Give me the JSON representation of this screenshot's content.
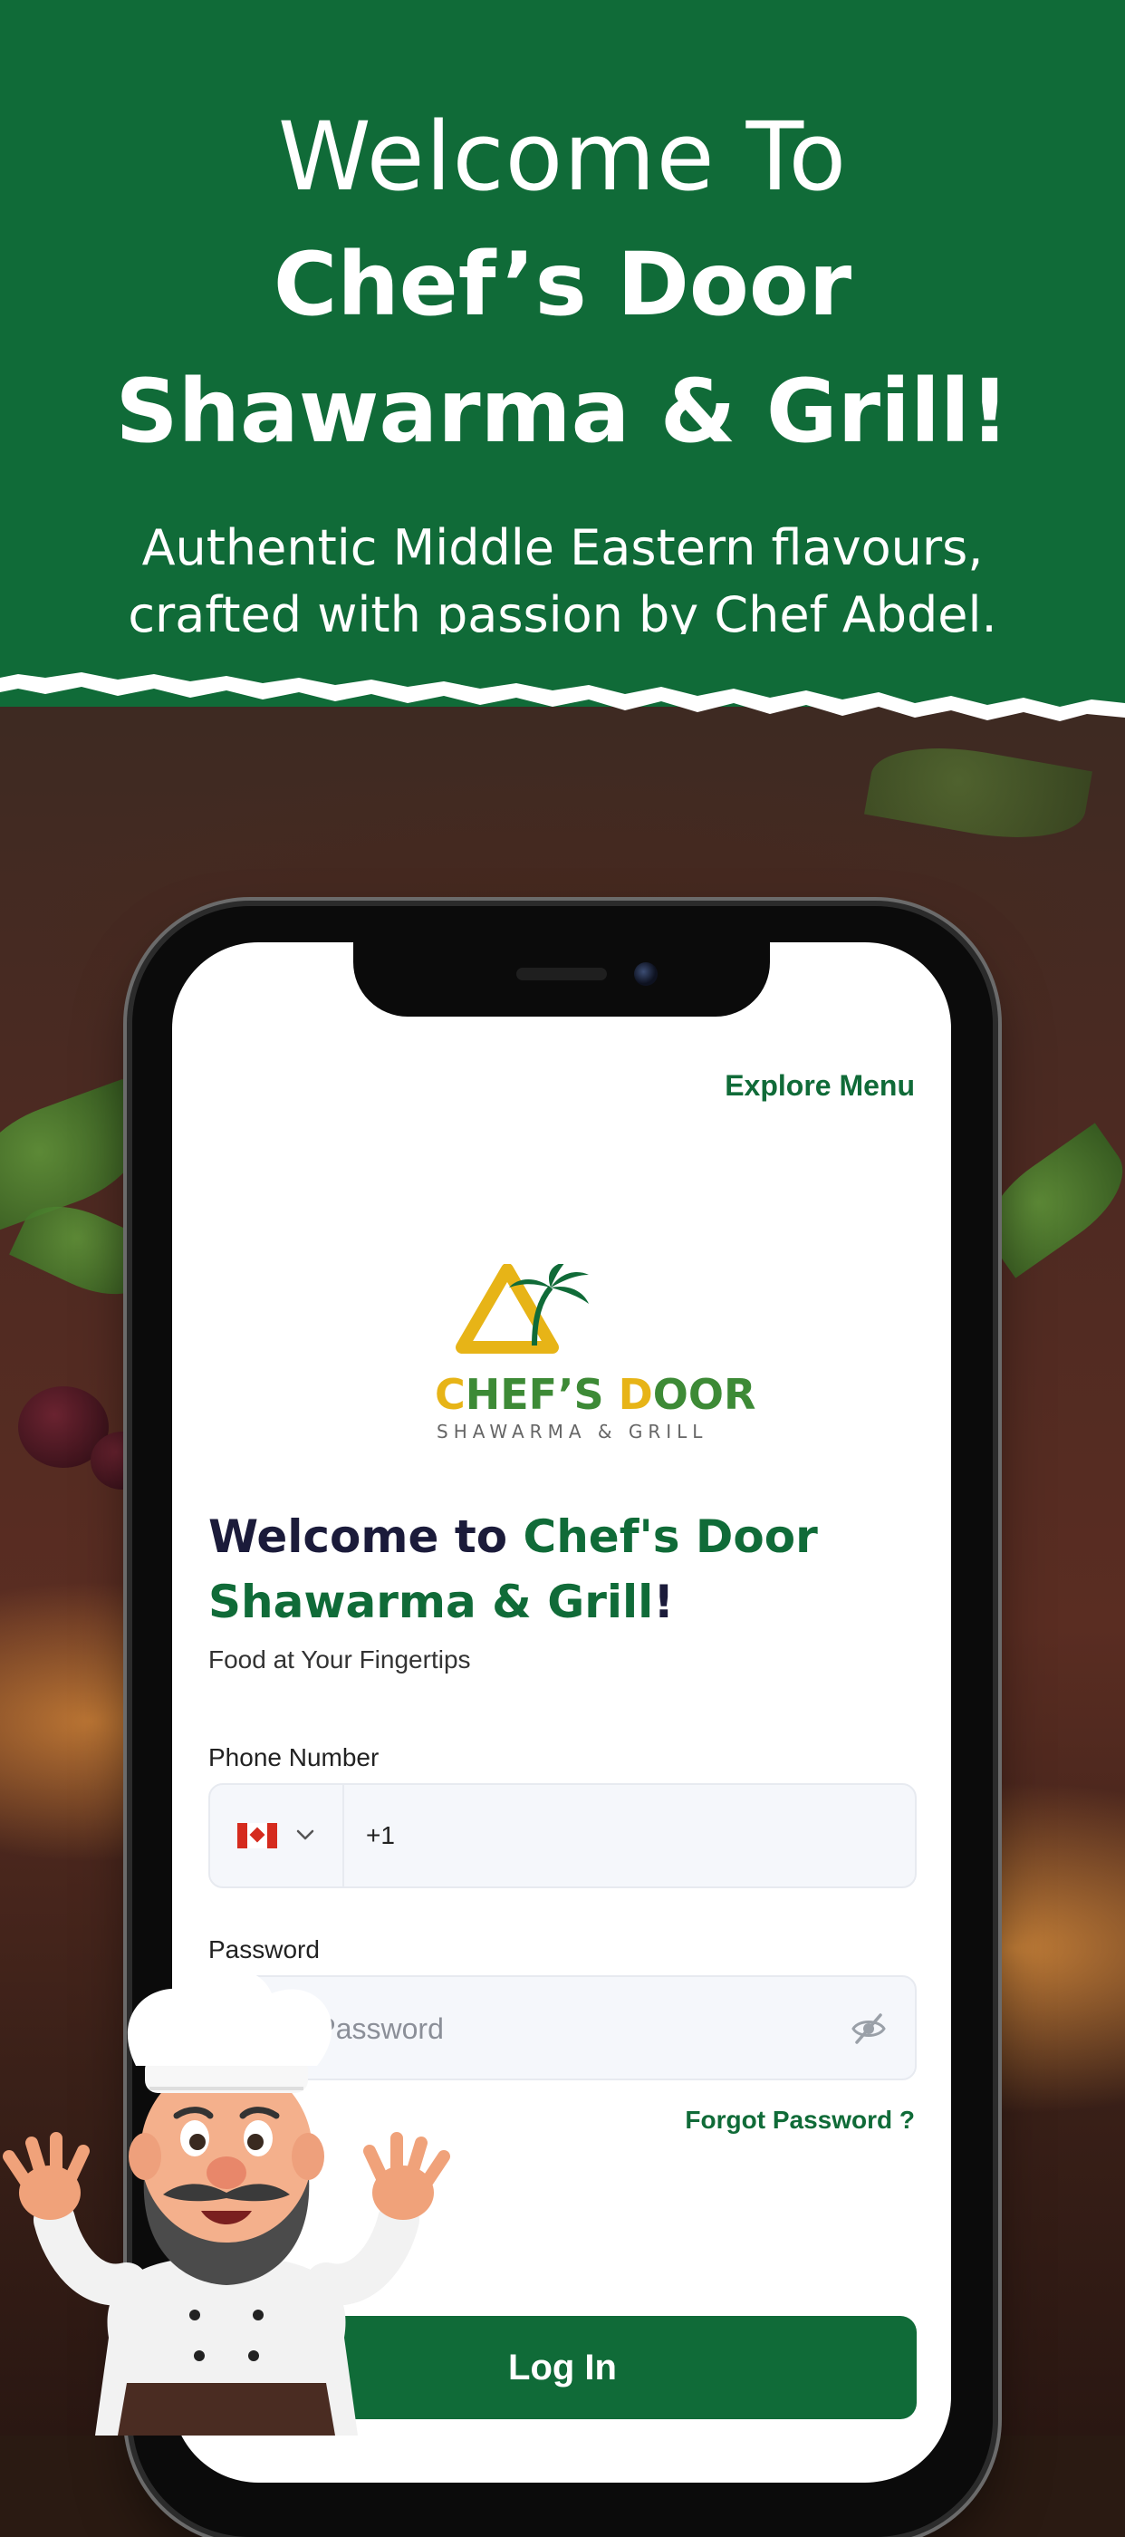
{
  "header": {
    "line1": "Welcome To",
    "line2": "Chef’s Door",
    "line3": "Shawarma & Grill!",
    "subtitle_line1": "Authentic Middle Eastern flavours,",
    "subtitle_line2": "crafted with passion by Chef Abdel.",
    "color": "#106b38"
  },
  "app": {
    "explore_menu": "Explore  Menu",
    "logo": {
      "word_part1": "C",
      "word_part2": "HEF’S ",
      "word_part3": "D",
      "word_part4": "OOR",
      "tagline": "SHAWARMA & GRILL"
    },
    "welcome_prefix": "Welcome to ",
    "welcome_brand_line1": "Chef's Door",
    "welcome_brand_line2": "Shawarma & Grill",
    "welcome_suffix": "!",
    "tagline": "Food at Your Fingertips",
    "phone": {
      "label": "Phone Number",
      "country": "CA",
      "country_code": "+1",
      "flag_icon": "canada-flag-icon"
    },
    "password": {
      "label": "Password",
      "placeholder": "Enter Password",
      "visibility_icon": "eye-off-icon"
    },
    "forgot_password": "Forgot Password ?",
    "login_button": "Log In",
    "accent_color": "#106b38",
    "brand_yellow": "#e7b417"
  }
}
